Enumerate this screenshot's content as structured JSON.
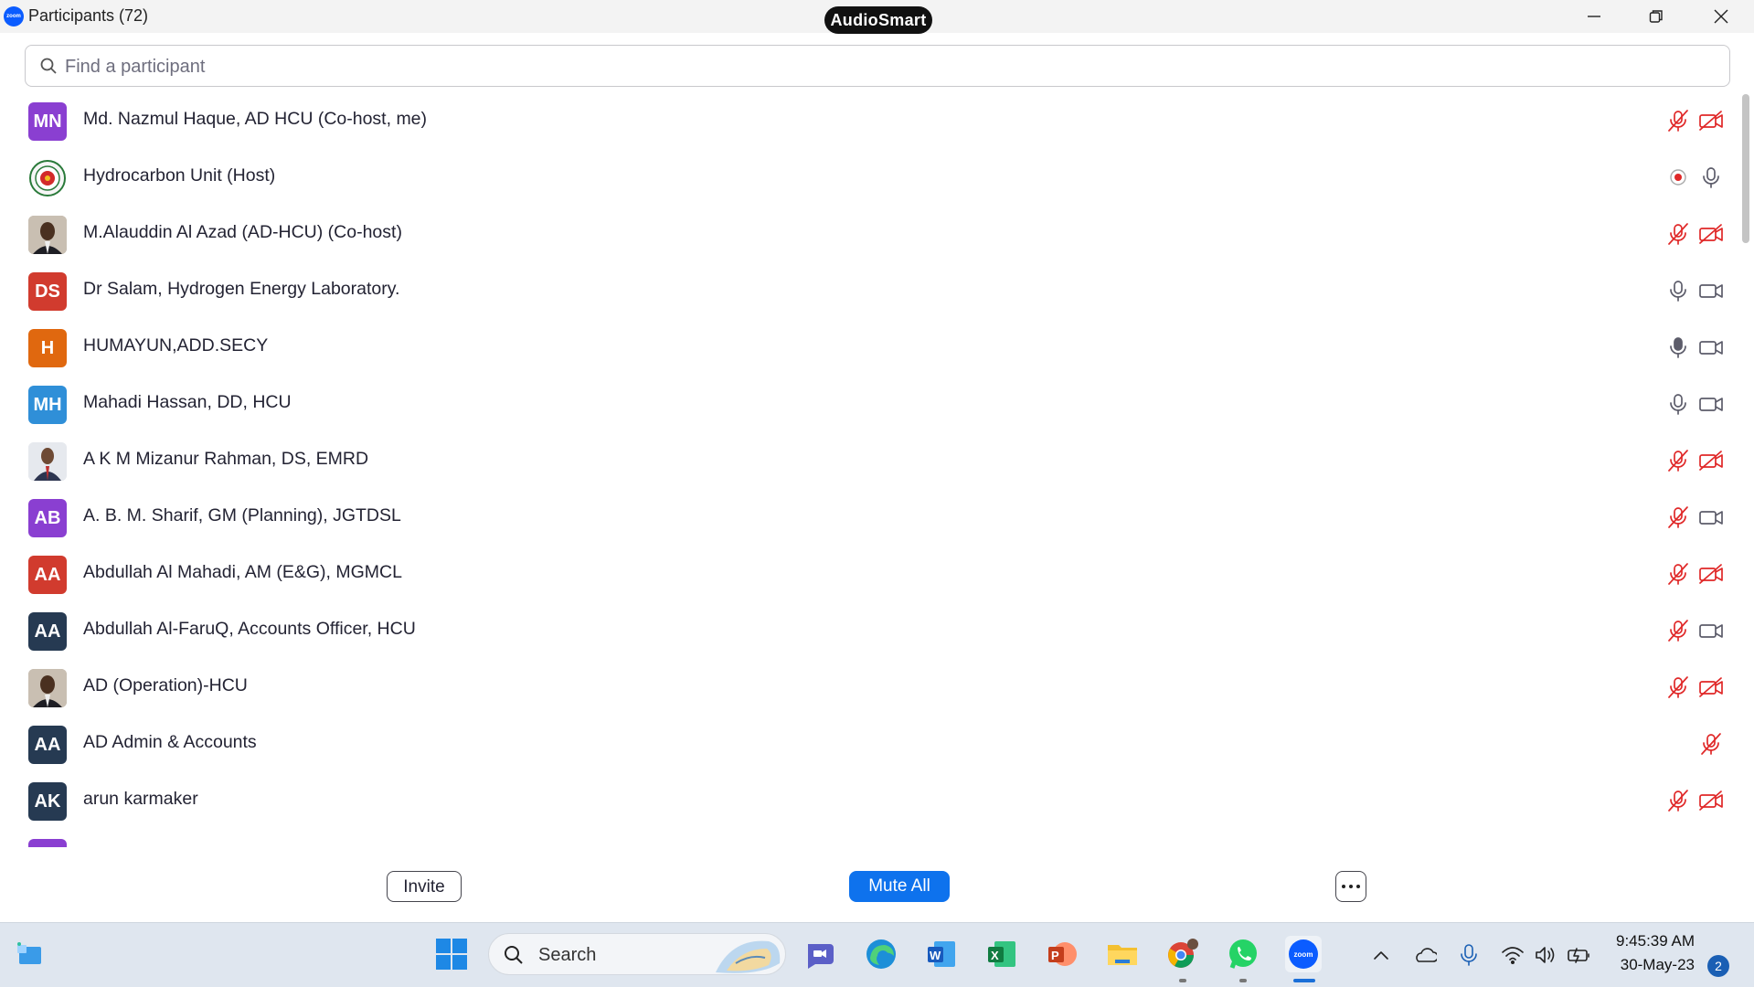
{
  "window": {
    "title": "Participants (72)",
    "app_icon_label": "zoom",
    "badge": "AudioSmart"
  },
  "search": {
    "placeholder": "Find a participant",
    "value": ""
  },
  "participants": [
    {
      "initials": "MN",
      "name": "Md. Nazmul Haque, AD HCU (Co-host, me)",
      "avatar_color": "#8a3fd1",
      "avatar_type": "initials",
      "status_icon": null,
      "mic": "muted",
      "video": "off"
    },
    {
      "initials": "",
      "name": "Hydrocarbon Unit (Host)",
      "avatar_color": "#ffffff",
      "avatar_type": "emblem",
      "status_icon": "recording-icon",
      "mic": "on",
      "video": null
    },
    {
      "initials": "",
      "name": "M.Alauddin Al Azad (AD-HCU) (Co-host)",
      "avatar_color": "#6b5a4a",
      "avatar_type": "photo",
      "status_icon": null,
      "mic": "muted",
      "video": "off"
    },
    {
      "initials": "DS",
      "name": "Dr Salam, Hydrogen Energy Laboratory.",
      "avatar_color": "#d13b2e",
      "avatar_type": "initials",
      "status_icon": null,
      "mic": "on",
      "video": "on"
    },
    {
      "initials": "H",
      "name": "HUMAYUN,ADD.SECY",
      "avatar_color": "#e0680f",
      "avatar_type": "initials",
      "status_icon": null,
      "mic": "on-filled",
      "video": "on"
    },
    {
      "initials": "MH",
      "name": "Mahadi Hassan, DD, HCU",
      "avatar_color": "#2f8fd8",
      "avatar_type": "initials",
      "status_icon": null,
      "mic": "on",
      "video": "on"
    },
    {
      "initials": "",
      "name": "A K M Mizanur Rahman, DS, EMRD",
      "avatar_color": "#8a97a8",
      "avatar_type": "photo",
      "status_icon": null,
      "mic": "muted",
      "video": "off"
    },
    {
      "initials": "AB",
      "name": "A. B. M. Sharif, GM (Planning), JGTDSL",
      "avatar_color": "#8a3fd1",
      "avatar_type": "initials",
      "status_icon": null,
      "mic": "muted",
      "video": "on"
    },
    {
      "initials": "AA",
      "name": "Abdullah Al Mahadi, AM (E&G), MGMCL",
      "avatar_color": "#d13b2e",
      "avatar_type": "initials",
      "status_icon": null,
      "mic": "muted",
      "video": "off"
    },
    {
      "initials": "AA",
      "name": "Abdullah Al-FaruQ, Accounts Officer, HCU",
      "avatar_color": "#263a52",
      "avatar_type": "initials",
      "status_icon": null,
      "mic": "muted",
      "video": "on"
    },
    {
      "initials": "",
      "name": "AD (Operation)-HCU",
      "avatar_color": "#6b5a4a",
      "avatar_type": "photo",
      "status_icon": null,
      "mic": "muted",
      "video": "off"
    },
    {
      "initials": "AA",
      "name": "AD Admin & Accounts",
      "avatar_color": "#263a52",
      "avatar_type": "initials",
      "status_icon": null,
      "mic": null,
      "video": "muted-mic-only"
    },
    {
      "initials": "AK",
      "name": "arun karmaker",
      "avatar_color": "#263a52",
      "avatar_type": "initials",
      "status_icon": null,
      "mic": "muted",
      "video": "off"
    }
  ],
  "footer": {
    "invite_label": "Invite",
    "mute_all_label": "Mute All",
    "more_icon": "more-icon"
  },
  "taskbar": {
    "search_placeholder": "Search",
    "apps": [
      "widgets-icon",
      "start-icon",
      "teams-chat-icon",
      "edge-icon",
      "word-icon",
      "excel-icon",
      "powerpoint-icon",
      "file-explorer-icon",
      "chrome-icon",
      "whatsapp-icon",
      "zoom-icon"
    ],
    "tray_icons": [
      "chevron-up-icon",
      "onedrive-icon",
      "microphone-icon",
      "wifi-icon",
      "volume-icon",
      "battery-icon"
    ],
    "time": "9:45:39 AM",
    "date": "30-May-23",
    "notification_count": "2",
    "zoom_label": "zoom"
  },
  "colors": {
    "accent": "#0e72ed",
    "muted_red": "#e02828",
    "icon_gray": "#5c5c6a",
    "titlebar_bg": "#f3f3f3",
    "taskbar_bg": "#dfe6ef"
  }
}
